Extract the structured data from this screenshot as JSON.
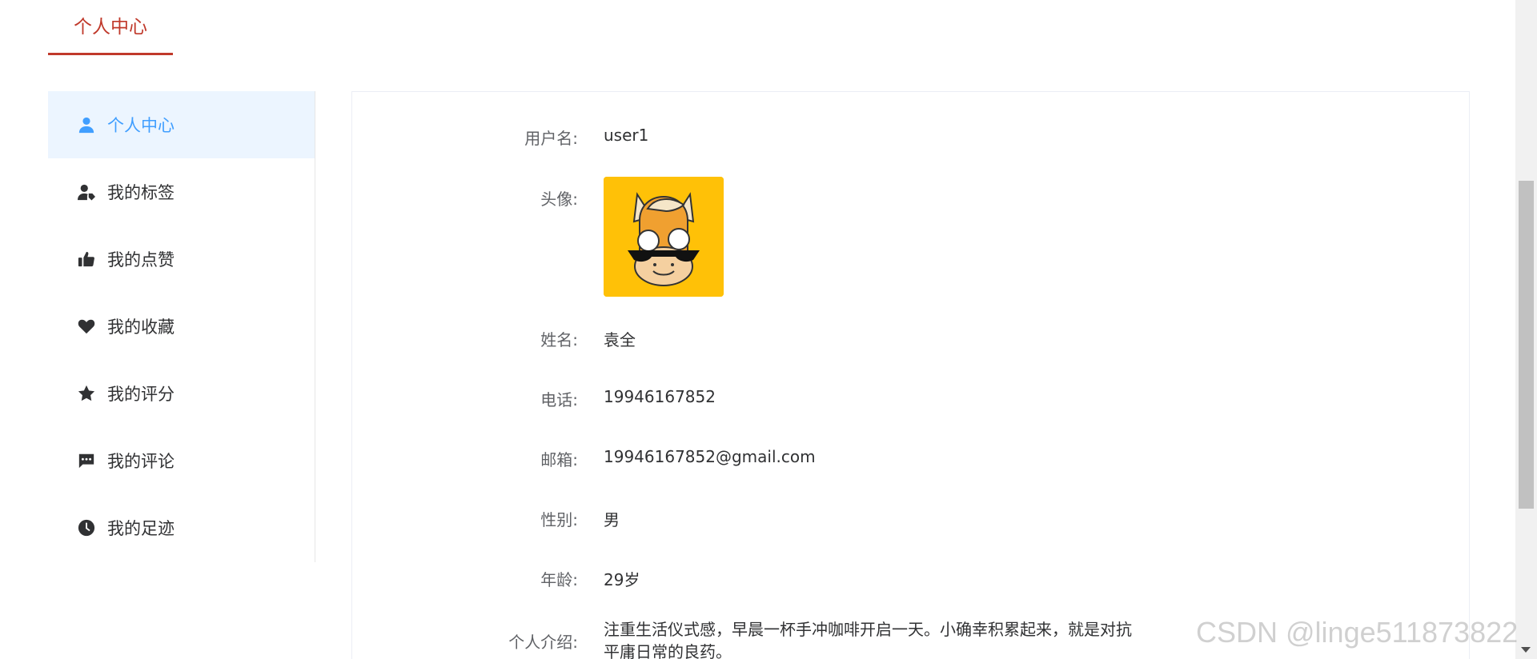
{
  "top_tab": {
    "label": "个人中心"
  },
  "sidebar": {
    "items": [
      {
        "label": "个人中心",
        "icon": "user-icon",
        "active": true
      },
      {
        "label": "我的标签",
        "icon": "user-tag-icon",
        "active": false
      },
      {
        "label": "我的点赞",
        "icon": "thumbs-up-icon",
        "active": false
      },
      {
        "label": "我的收藏",
        "icon": "heart-icon",
        "active": false
      },
      {
        "label": "我的评分",
        "icon": "star-icon",
        "active": false
      },
      {
        "label": "我的评论",
        "icon": "comment-icon",
        "active": false
      },
      {
        "label": "我的足迹",
        "icon": "clock-icon",
        "active": false
      }
    ]
  },
  "profile": {
    "username_label": "用户名:",
    "username": "user1",
    "avatar_label": "头像:",
    "name_label": "姓名:",
    "name": "袁全",
    "phone_label": "电话:",
    "phone": "19946167852",
    "email_label": "邮箱:",
    "email": "19946167852@gmail.com",
    "gender_label": "性别:",
    "gender": "男",
    "age_label": "年龄:",
    "age": "29岁",
    "intro_label": "个人介绍:",
    "intro": "注重生活仪式感，早晨一杯手冲咖啡开启一天。小确幸积累起来，就是对抗平庸日常的良药。"
  },
  "watermark": "CSDN @linge511873822",
  "colors": {
    "accent": "#c0392b",
    "active_blue": "#409eff",
    "active_bg": "#ecf5ff",
    "avatar_bg": "#ffc107"
  }
}
